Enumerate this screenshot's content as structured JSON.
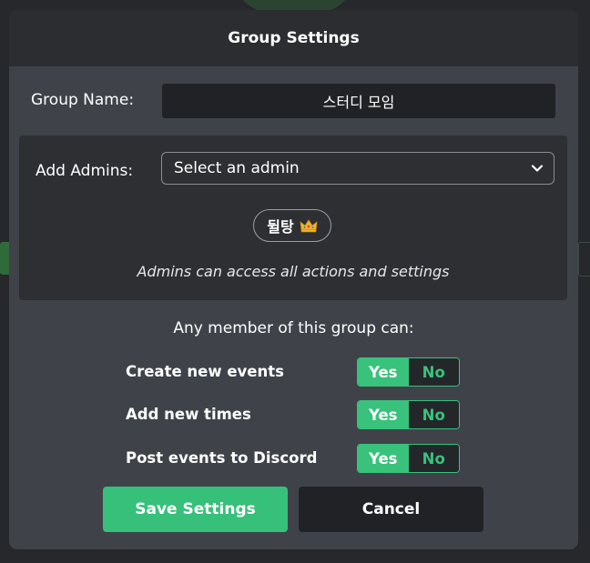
{
  "modal": {
    "title": "Group Settings"
  },
  "group_name": {
    "label": "Group Name:",
    "value": "스터디 모임"
  },
  "admins": {
    "label": "Add Admins:",
    "select_value": "Select an admin",
    "current_admin": "뒬탕",
    "current_admin_icon": "crown-icon",
    "note": "Admins can access all actions and settings"
  },
  "permissions": {
    "heading": "Any member of this group can:",
    "items": [
      {
        "label": "Create new events",
        "selected": "Yes"
      },
      {
        "label": "Add new times",
        "selected": "Yes"
      },
      {
        "label": "Post events to Discord",
        "selected": "Yes"
      }
    ],
    "yes_label": "Yes",
    "no_label": "No"
  },
  "buttons": {
    "save_label": "Save Settings",
    "cancel_label": "Cancel"
  },
  "colors": {
    "accent": "#38c27b",
    "modal_bg": "#3f4349",
    "header_bg": "#2b2d31",
    "input_bg": "#212226"
  }
}
